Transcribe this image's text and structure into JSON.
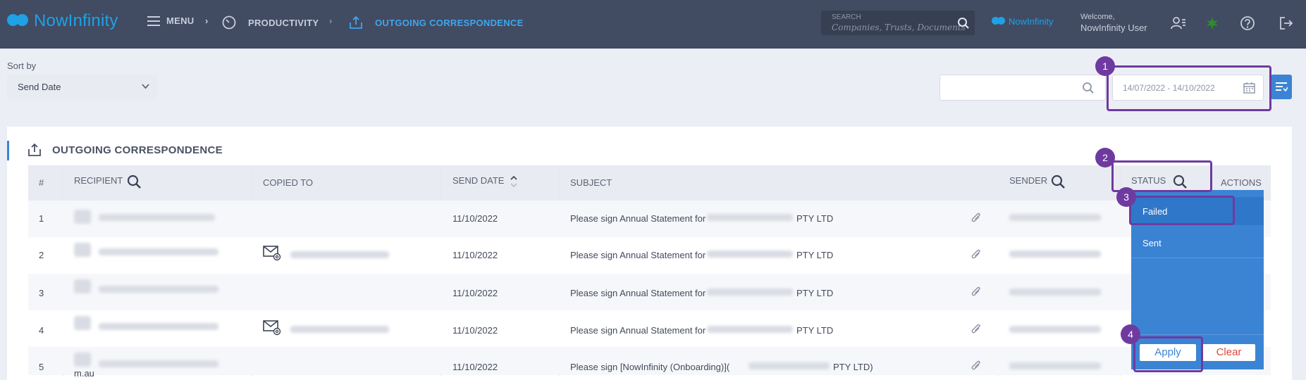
{
  "header": {
    "logo_text": "NowInfinity",
    "menu_label": "MENU",
    "breadcrumb_sep": "›",
    "productivity_label": "PRODUCTIVITY",
    "current_label": "OUTGOING CORRESPONDENCE",
    "search_label": "SEARCH",
    "search_placeholder": "Companies, Trusts, Documents",
    "brand_small": "NowInfinity",
    "welcome": "Welcome,",
    "user_name": "NowInfinity User"
  },
  "toolbar": {
    "sort_label": "Sort by",
    "sort_value": "Send Date",
    "date_range": "14/07/2022 - 14/10/2022"
  },
  "panel": {
    "title": "OUTGOING CORRESPONDENCE"
  },
  "table": {
    "headers": [
      "#",
      "RECIPIENT",
      "COPIED TO",
      "SEND DATE",
      "SUBJECT",
      "SENDER",
      "STATUS",
      "ACTIONS"
    ],
    "rows": [
      {
        "num": "1",
        "date": "11/10/2022",
        "subject": "Please sign Annual Statement for",
        "suffix": "PTY LTD"
      },
      {
        "num": "2",
        "date": "11/10/2022",
        "subject": "Please sign Annual Statement for",
        "suffix": "PTY LTD"
      },
      {
        "num": "3",
        "date": "11/10/2022",
        "subject": "Please sign Annual Statement for",
        "suffix": "PTY LTD"
      },
      {
        "num": "4",
        "date": "11/10/2022",
        "subject": "Please sign Annual Statement for",
        "suffix": "PTY LTD"
      },
      {
        "num": "5",
        "date": "11/10/2022",
        "subject": "Please sign [NowInfinity (Onboarding)](",
        "suffix": "PTY LTD)",
        "recipient_tail": "m.au"
      }
    ]
  },
  "status_dropdown": {
    "options": [
      "Failed",
      "Sent"
    ],
    "apply": "Apply",
    "clear": "Clear"
  },
  "callouts": [
    "1",
    "2",
    "3",
    "4"
  ],
  "colors": {
    "header_bg": "#414b62",
    "accent": "#1fa1e6",
    "dropdown_bg": "#3b84d4",
    "callout": "#6f3aa0",
    "clear": "#e0483e"
  }
}
